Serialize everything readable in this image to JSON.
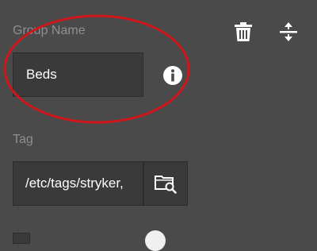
{
  "group": {
    "label": "Group Name",
    "value": "Beds"
  },
  "tag": {
    "label": "Tag",
    "value": "/etc/tags/stryker,"
  },
  "icons": {
    "delete": "trash-icon",
    "reorder": "expand-collapse-icon",
    "info": "info-icon",
    "browse": "folder-search-icon"
  },
  "colors": {
    "background": "#4a4a4a",
    "field_bg": "#3a3a3a",
    "label": "#8f8f8f",
    "text": "#ffffff",
    "highlight": "#d0161b"
  }
}
